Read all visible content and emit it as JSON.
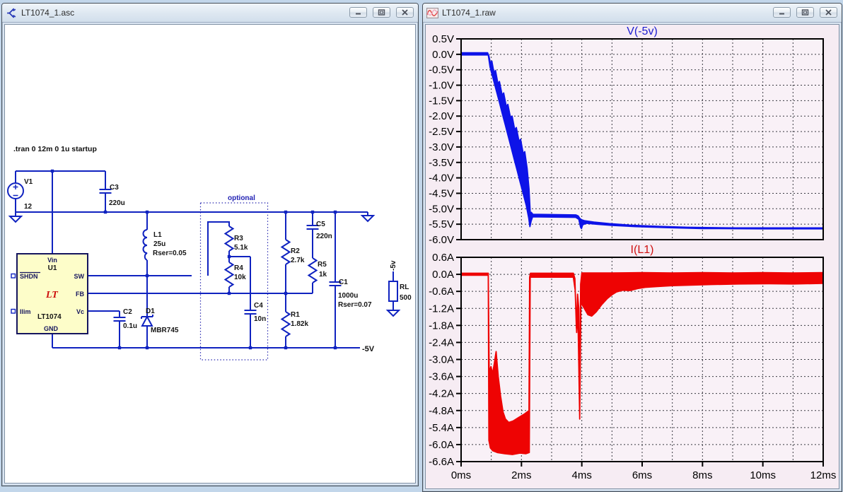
{
  "windows": {
    "schematic": {
      "title": "LT1074_1.asc"
    },
    "waveform": {
      "title": "LT1074_1.raw"
    }
  },
  "schematic": {
    "directive": ".tran 0 12m 0 1u startup",
    "optional_label": "optional",
    "net_labels": {
      "rail": "-5V",
      "flag": "-5v"
    },
    "ic": {
      "refdes": "U1",
      "part": "LT1074",
      "pins": {
        "vin": "Vin",
        "shdn": "SHDN",
        "ilim": "Ilim",
        "sw": "SW",
        "fb": "FB",
        "vc": "Vc",
        "gnd": "GND"
      }
    },
    "components": {
      "v1": {
        "name": "V1",
        "value": "12"
      },
      "c3": {
        "name": "C3",
        "value": "220u"
      },
      "l1": {
        "name": "L1",
        "value": "25u",
        "param": "Rser=0.05"
      },
      "r3": {
        "name": "R3",
        "value": "5.1k"
      },
      "r4": {
        "name": "R4",
        "value": "10k"
      },
      "c4": {
        "name": "C4",
        "value": "10n"
      },
      "r2": {
        "name": "R2",
        "value": "2.7k"
      },
      "c5": {
        "name": "C5",
        "value": "220n"
      },
      "r5": {
        "name": "R5",
        "value": "1k"
      },
      "c1": {
        "name": "C1",
        "value": "1000u",
        "param": "Rser=0.07"
      },
      "r1": {
        "name": "R1",
        "value": "1.82k"
      },
      "rl": {
        "name": "RL",
        "value": "500"
      },
      "d1": {
        "name": "D1",
        "value": "MBR745"
      },
      "c2": {
        "name": "C2",
        "value": "0.1u"
      }
    }
  },
  "x_axis": {
    "tick_labels": [
      "0ms",
      "2ms",
      "4ms",
      "6ms",
      "8ms",
      "10ms",
      "12ms"
    ],
    "minor_grid_ms": 1
  },
  "chart_data": [
    {
      "type": "area",
      "title": "V(-5v)",
      "color": "#0d13e8",
      "title_color": "#1b1bd0",
      "xlim": [
        0,
        12
      ],
      "x_unit": "ms",
      "ylim": [
        -6.0,
        0.5
      ],
      "ytick_labels": [
        "0.5V",
        "0.0V",
        "-0.5V",
        "-1.0V",
        "-1.5V",
        "-2.0V",
        "-2.5V",
        "-3.0V",
        "-3.5V",
        "-4.0V",
        "-4.5V",
        "-5.0V",
        "-5.5V",
        "-6.0V"
      ],
      "grid": true,
      "series": [
        {
          "name": "V(-5v)",
          "upper": [
            [
              0,
              0.05
            ],
            [
              0.88,
              0.05
            ],
            [
              0.92,
              -0.05
            ],
            [
              0.97,
              -0.28
            ],
            [
              1.02,
              -0.22
            ],
            [
              1.09,
              -0.6
            ],
            [
              1.14,
              -0.52
            ],
            [
              1.22,
              -0.95
            ],
            [
              1.27,
              -0.88
            ],
            [
              1.36,
              -1.32
            ],
            [
              1.41,
              -1.25
            ],
            [
              1.5,
              -1.7
            ],
            [
              1.55,
              -1.62
            ],
            [
              1.64,
              -2.07
            ],
            [
              1.69,
              -2.0
            ],
            [
              1.78,
              -2.45
            ],
            [
              1.83,
              -2.37
            ],
            [
              1.92,
              -2.82
            ],
            [
              1.97,
              -2.75
            ],
            [
              2.06,
              -3.22
            ],
            [
              2.11,
              -3.15
            ],
            [
              2.19,
              -3.7
            ],
            [
              2.25,
              -4.35
            ],
            [
              2.29,
              -5.1
            ],
            [
              2.33,
              -5.12
            ],
            [
              2.38,
              -5.18
            ],
            [
              3.8,
              -5.2
            ],
            [
              3.88,
              -5.23
            ],
            [
              3.94,
              -5.32
            ],
            [
              4.0,
              -5.36
            ],
            [
              4.1,
              -5.39
            ],
            [
              4.4,
              -5.43
            ],
            [
              4.9,
              -5.48
            ],
            [
              5.6,
              -5.53
            ],
            [
              6.5,
              -5.57
            ],
            [
              7.5,
              -5.6
            ],
            [
              9.0,
              -5.62
            ],
            [
              12,
              -5.62
            ]
          ],
          "lower": [
            [
              0,
              -0.02
            ],
            [
              0.9,
              -0.02
            ],
            [
              0.96,
              -0.42
            ],
            [
              1.06,
              -0.78
            ],
            [
              1.16,
              -1.15
            ],
            [
              1.26,
              -1.52
            ],
            [
              1.36,
              -1.9
            ],
            [
              1.46,
              -2.27
            ],
            [
              1.56,
              -2.65
            ],
            [
              1.66,
              -3.02
            ],
            [
              1.76,
              -3.4
            ],
            [
              1.86,
              -3.77
            ],
            [
              1.96,
              -4.15
            ],
            [
              2.06,
              -4.52
            ],
            [
              2.16,
              -4.9
            ],
            [
              2.24,
              -5.3
            ],
            [
              2.28,
              -5.58
            ],
            [
              2.32,
              -5.4
            ],
            [
              2.37,
              -5.26
            ],
            [
              3.8,
              -5.28
            ],
            [
              3.9,
              -5.34
            ],
            [
              3.96,
              -5.6
            ],
            [
              3.99,
              -5.64
            ],
            [
              4.03,
              -5.52
            ],
            [
              4.15,
              -5.47
            ],
            [
              4.5,
              -5.5
            ],
            [
              5.0,
              -5.54
            ],
            [
              5.8,
              -5.58
            ],
            [
              6.8,
              -5.61
            ],
            [
              8.0,
              -5.64
            ],
            [
              10,
              -5.65
            ],
            [
              12,
              -5.65
            ]
          ]
        }
      ]
    },
    {
      "type": "area",
      "title": "I(L1)",
      "color": "#ee0303",
      "title_color": "#cf1212",
      "xlim": [
        0,
        12
      ],
      "x_unit": "ms",
      "ylim": [
        -6.6,
        0.6
      ],
      "ytick_labels": [
        "0.6A",
        "0.0A",
        "-0.6A",
        "-1.2A",
        "-1.8A",
        "-2.4A",
        "-3.0A",
        "-3.6A",
        "-4.2A",
        "-4.8A",
        "-5.4A",
        "-6.0A",
        "-6.6A"
      ],
      "grid": true,
      "series": [
        {
          "name": "I(L1)",
          "upper": [
            [
              0,
              0.04
            ],
            [
              0.9,
              0.04
            ],
            [
              0.93,
              -3.45
            ],
            [
              0.99,
              -3.25
            ],
            [
              1.04,
              -3.5
            ],
            [
              1.1,
              -3.15
            ],
            [
              1.16,
              -2.72
            ],
            [
              1.23,
              -3.6
            ],
            [
              1.31,
              -4.3
            ],
            [
              1.39,
              -4.85
            ],
            [
              1.47,
              -5.1
            ],
            [
              1.58,
              -5.22
            ],
            [
              1.72,
              -5.17
            ],
            [
              1.9,
              -5.05
            ],
            [
              2.1,
              -4.92
            ],
            [
              2.25,
              -4.8
            ],
            [
              2.27,
              -0.1
            ],
            [
              2.3,
              0.04
            ],
            [
              3.72,
              0.04
            ],
            [
              3.77,
              -0.15
            ],
            [
              3.82,
              -1.9
            ],
            [
              3.86,
              -0.7
            ],
            [
              3.9,
              -1.2
            ],
            [
              3.93,
              -4.9
            ],
            [
              3.96,
              -0.35
            ],
            [
              4.0,
              0.05
            ],
            [
              5.0,
              0.05
            ],
            [
              6.0,
              0.06
            ],
            [
              7.0,
              0.05
            ],
            [
              8.0,
              0.06
            ],
            [
              9.0,
              0.05
            ],
            [
              10.0,
              0.06
            ],
            [
              11.0,
              0.05
            ],
            [
              12.0,
              0.06
            ]
          ],
          "lower": [
            [
              0,
              -0.03
            ],
            [
              0.9,
              -0.03
            ],
            [
              0.92,
              -5.85
            ],
            [
              0.97,
              -6.12
            ],
            [
              1.05,
              -6.22
            ],
            [
              1.2,
              -6.28
            ],
            [
              1.45,
              -6.32
            ],
            [
              1.7,
              -6.35
            ],
            [
              1.95,
              -6.3
            ],
            [
              2.15,
              -6.32
            ],
            [
              2.26,
              -6.28
            ],
            [
              2.29,
              -0.1
            ],
            [
              3.72,
              -0.1
            ],
            [
              3.78,
              -0.55
            ],
            [
              3.83,
              -2.05
            ],
            [
              3.87,
              -1.25
            ],
            [
              3.93,
              -5.1
            ],
            [
              3.97,
              -1.0
            ],
            [
              4.07,
              -1.18
            ],
            [
              4.2,
              -1.42
            ],
            [
              4.33,
              -1.47
            ],
            [
              4.48,
              -1.32
            ],
            [
              4.65,
              -1.08
            ],
            [
              4.85,
              -0.85
            ],
            [
              5.0,
              -0.72
            ],
            [
              5.15,
              -0.62
            ],
            [
              5.35,
              -0.56
            ],
            [
              5.6,
              -0.57
            ],
            [
              5.85,
              -0.5
            ],
            [
              6.1,
              -0.46
            ],
            [
              6.5,
              -0.43
            ],
            [
              7.0,
              -0.4
            ],
            [
              7.6,
              -0.38
            ],
            [
              8.3,
              -0.36
            ],
            [
              9.2,
              -0.34
            ],
            [
              10.2,
              -0.33
            ],
            [
              11.0,
              -0.34
            ],
            [
              12.0,
              -0.32
            ]
          ]
        }
      ]
    }
  ]
}
